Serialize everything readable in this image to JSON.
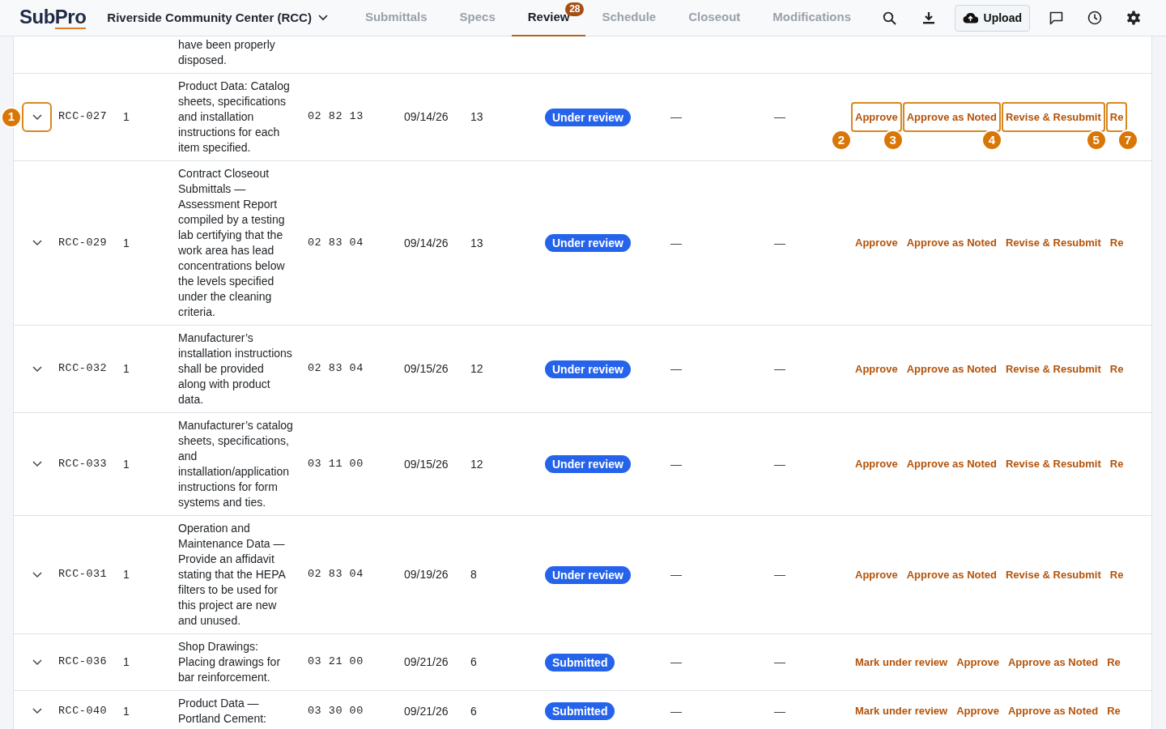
{
  "header": {
    "logo": {
      "main": "Sub",
      "accent": "Pro"
    },
    "project": "Riverside Community Center (RCC)",
    "tabs": [
      {
        "label": "Submittals",
        "selected": false
      },
      {
        "label": "Specs",
        "selected": false
      },
      {
        "label": "Review",
        "selected": true,
        "badge": "28"
      },
      {
        "label": "Schedule",
        "selected": false
      },
      {
        "label": "Closeout",
        "selected": false
      },
      {
        "label": "Modifications",
        "selected": false
      }
    ],
    "upload_label": "Upload"
  },
  "rows": [
    {
      "kind": "partial",
      "description": "have been properly disposed."
    },
    {
      "kind": "full",
      "highlighted": true,
      "toggle_marker": "1",
      "end_marker": "7",
      "number": "RCC-027",
      "revision": "1",
      "description": "Product Data: Catalog sheets, specifications and installation instructions for each item specified.",
      "spec_section": "02 82 13",
      "date": "09/14/26",
      "days": "13",
      "status": "Under review",
      "column_9": "—",
      "column_10": "—",
      "actions": [
        {
          "label": "Approve",
          "marker": "2"
        },
        {
          "label": "Approve as Noted",
          "marker": "3"
        },
        {
          "label": "Revise & Resubmit",
          "marker": "4"
        },
        {
          "label": "Re",
          "marker": "5"
        }
      ]
    },
    {
      "kind": "full",
      "highlighted": false,
      "number": "RCC-029",
      "revision": "1",
      "description": "Contract Closeout Submittals — Assessment Report compiled by a testing lab certifying that the work area has lead concentrations below the levels specified under the cleaning criteria.",
      "spec_section": "02 83 04",
      "date": "09/14/26",
      "days": "13",
      "status": "Under review",
      "column_9": "—",
      "column_10": "—",
      "actions": [
        {
          "label": "Approve"
        },
        {
          "label": "Approve as Noted"
        },
        {
          "label": "Revise & Resubmit"
        },
        {
          "label": "Re"
        }
      ]
    },
    {
      "kind": "full",
      "highlighted": false,
      "number": "RCC-032",
      "revision": "1",
      "description": "Manufacturer’s installation instructions shall be provided along with product data.",
      "spec_section": "02 83 04",
      "date": "09/15/26",
      "days": "12",
      "status": "Under review",
      "column_9": "—",
      "column_10": "—",
      "actions": [
        {
          "label": "Approve"
        },
        {
          "label": "Approve as Noted"
        },
        {
          "label": "Revise & Resubmit"
        },
        {
          "label": "Re"
        }
      ]
    },
    {
      "kind": "full",
      "highlighted": false,
      "number": "RCC-033",
      "revision": "1",
      "description": "Manufacturer’s catalog sheets, specifications, and installation/application instructions for form systems and ties.",
      "spec_section": "03 11 00",
      "date": "09/15/26",
      "days": "12",
      "status": "Under review",
      "column_9": "—",
      "column_10": "—",
      "actions": [
        {
          "label": "Approve"
        },
        {
          "label": "Approve as Noted"
        },
        {
          "label": "Revise & Resubmit"
        },
        {
          "label": "Re"
        }
      ]
    },
    {
      "kind": "full",
      "highlighted": false,
      "number": "RCC-031",
      "revision": "1",
      "description": "Operation and Maintenance Data — Provide an affidavit stating that the HEPA filters to be used for this project are new and unused.",
      "spec_section": "02 83 04",
      "date": "09/19/26",
      "days": "8",
      "status": "Under review",
      "column_9": "—",
      "column_10": "—",
      "actions": [
        {
          "label": "Approve"
        },
        {
          "label": "Approve as Noted"
        },
        {
          "label": "Revise & Resubmit"
        },
        {
          "label": "Re"
        }
      ]
    },
    {
      "kind": "full",
      "highlighted": false,
      "number": "RCC-036",
      "revision": "1",
      "description": "Shop Drawings: Placing drawings for bar reinforcement.",
      "spec_section": "03 21 00",
      "date": "09/21/26",
      "days": "6",
      "status": "Submitted",
      "column_9": "—",
      "column_10": "—",
      "actions": [
        {
          "label": "Mark under review"
        },
        {
          "label": "Approve"
        },
        {
          "label": "Approve as Noted"
        },
        {
          "label": "Re"
        }
      ]
    },
    {
      "kind": "full",
      "highlighted": false,
      "number": "RCC-040",
      "revision": "1",
      "description": "Product Data — Portland Cement:",
      "spec_section": "03 30 00",
      "date": "09/21/26",
      "days": "6",
      "status": "Submitted",
      "column_9": "—",
      "column_10": "—",
      "actions": [
        {
          "label": "Mark under review"
        },
        {
          "label": "Approve"
        },
        {
          "label": "Approve as Noted"
        },
        {
          "label": "Re"
        }
      ]
    }
  ]
}
